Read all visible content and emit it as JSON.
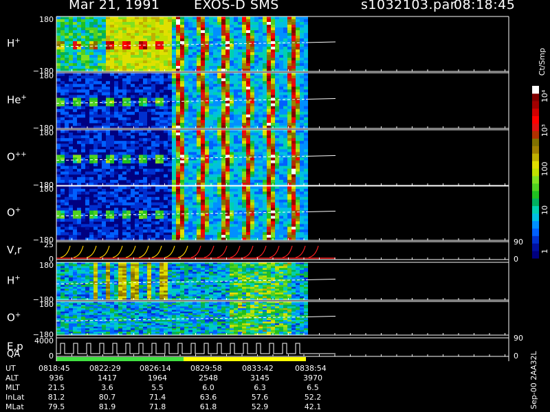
{
  "header": {
    "date": "Mar 21, 1991",
    "instrument": "EXOS-D SMS",
    "file": "s1032103.par",
    "time": "08:18:45"
  },
  "colorbar": {
    "unit": "Ct/Smp",
    "ticks": [
      "10⁴",
      "10³",
      "100",
      "10",
      "1"
    ],
    "colors": [
      "#000080",
      "#0010a0",
      "#0030d0",
      "#0060ff",
      "#0090ff",
      "#00c0e0",
      "#00d0b0",
      "#00b060",
      "#20c020",
      "#50d020",
      "#80e020",
      "#c0e000",
      "#e0e000",
      "#c0b000",
      "#a08000",
      "#807000",
      "#b03000",
      "#e01010",
      "#ff0000",
      "#d00000",
      "#a00000",
      "#800000",
      "#ffffff"
    ]
  },
  "chart_data": {
    "type": "heatmap",
    "x_time_ticks": [
      "0818:45",
      "0822:29",
      "0826:14",
      "0829:58",
      "0833:42",
      "0838:54"
    ],
    "panels": [
      {
        "label": "H",
        "superscript": "+",
        "ytop": "180",
        "ybot": "−180",
        "kind": "spectro"
      },
      {
        "label": "He",
        "superscript": "+",
        "ytop": "180",
        "ybot": "−180",
        "kind": "spectro"
      },
      {
        "label": "O",
        "superscript": "++",
        "ytop": "180",
        "ybot": "−180",
        "kind": "spectro"
      },
      {
        "label": "O",
        "superscript": "+",
        "ytop": "180",
        "ybot": "−180",
        "kind": "spectro"
      },
      {
        "label": "V,r",
        "superscript": "",
        "ytop": "25",
        "ybot": "0",
        "right_top": "90",
        "right_bot": "0",
        "kind": "line"
      },
      {
        "label": "H",
        "superscript": "+",
        "ytop": "180",
        "ybot": "−180",
        "kind": "spectro2"
      },
      {
        "label": "O",
        "superscript": "+",
        "ytop": "180",
        "ybot": "−180",
        "kind": "spectro2"
      },
      {
        "label": "E,p",
        "label2": "QA",
        "ytop": "4000",
        "ybot": "0",
        "right_top": "90",
        "right_bot": "0",
        "kind": "step"
      }
    ],
    "orbit_table": {
      "rows": [
        {
          "name": "UT",
          "values": [
            "0818:45",
            "0822:29",
            "0826:14",
            "0829:58",
            "0833:42",
            "0838:54"
          ]
        },
        {
          "name": "ALT",
          "values": [
            "936",
            "1417",
            "1964",
            "2548",
            "3145",
            "3970"
          ]
        },
        {
          "name": "MLT",
          "values": [
            "21.5",
            "3.6",
            "5.5",
            "6.0",
            "6.3",
            "6.5"
          ]
        },
        {
          "name": "InLat",
          "values": [
            "81.2",
            "80.7",
            "71.4",
            "63.6",
            "57.6",
            "52.2"
          ]
        },
        {
          "name": "MLat",
          "values": [
            "79.5",
            "81.9",
            "71.8",
            "61.8",
            "52.9",
            "42.1"
          ]
        }
      ]
    },
    "footer_label": "Sep-00 2AA32L"
  }
}
